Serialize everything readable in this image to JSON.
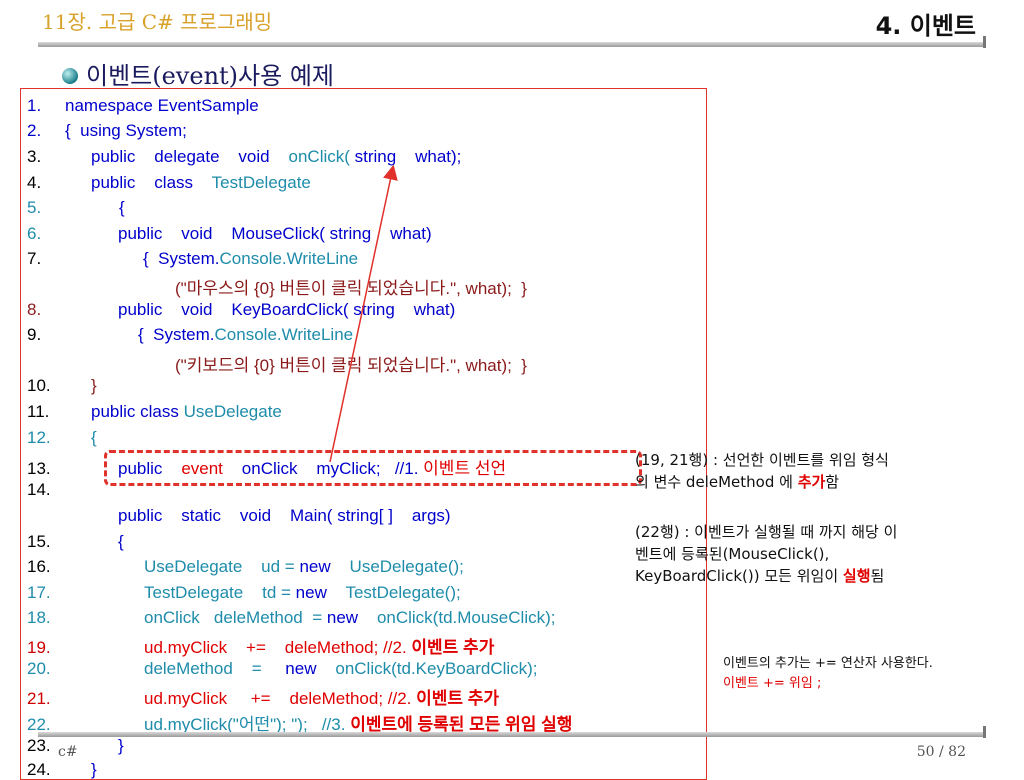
{
  "header": {
    "chapter": "11장. 고급 C# 프로그래밍",
    "section": "4. 이벤트",
    "heading": "이벤트(event)사용 예제"
  },
  "code": {
    "l1": {
      "num": "1.",
      "text": "namespace EventSample"
    },
    "l2": {
      "num": "2.",
      "text": "{  using System;"
    },
    "l3": {
      "num": "3.",
      "a": "public    delegate    void    ",
      "b": "onClick(",
      "c": " string    what);"
    },
    "l4": {
      "num": "4.",
      "a": "public    class    ",
      "b": "TestDelegate"
    },
    "l5": {
      "num": "5.",
      "text": "{"
    },
    "l6": {
      "num": "6.",
      "text": "public    void    MouseClick( string    what)"
    },
    "l7": {
      "num": "7.",
      "a": "{  System.",
      "b": "Console.WriteLine"
    },
    "l7b": {
      "text": "(\"마우스의 {0} 버튼이 클릭 되었습니다.\", what);  }"
    },
    "l8": {
      "num": "8.",
      "text": "public    void    KeyBoardClick( string    what)"
    },
    "l9": {
      "num": "9.",
      "a": "{  System.",
      "b": "Console.WriteLine"
    },
    "l9b": {
      "text": "(\"키보드의 {0} 버튼이 클릭 되었습니다.\", what);  }"
    },
    "l10": {
      "num": "10.",
      "text": "}"
    },
    "l11": {
      "num": "11.",
      "a": "public class ",
      "b": "UseDelegate"
    },
    "l12": {
      "num": "12.",
      "text": "{"
    },
    "l13": {
      "num": "13.",
      "a": "public    ",
      "b": "event    ",
      "c": "onClick    myClick;   //1. ",
      "d": "이벤트 선언"
    },
    "l14": {
      "num": "14.",
      "text": ""
    },
    "l14b": {
      "text": "public    static    void    Main( string[ ]    args)"
    },
    "l15": {
      "num": "15.",
      "text": "{"
    },
    "l16": {
      "num": "16.",
      "a": "UseDelegate    ud = ",
      "b": "new",
      "c": "    UseDelegate();"
    },
    "l17": {
      "num": "17.",
      "a": "TestDelegate    td = ",
      "b": "new",
      "c": "    TestDelegate();"
    },
    "l18": {
      "num": "18.",
      "a": "onClick   deleMethod  = ",
      "b": "new",
      "c": "    onClick(td.MouseClick);"
    },
    "l19": {
      "num": "19.",
      "a": "ud.myClick    +=    deleMethod; //2. ",
      "b": "이벤트 추가"
    },
    "l20": {
      "num": "20.",
      "a": "deleMethod    =     ",
      "b": "new",
      "c": "    onClick(td.KeyBoardClick);"
    },
    "l21": {
      "num": "21.",
      "a": "ud.myClick     +=    deleMethod; //2. ",
      "b": "이벤트 추가"
    },
    "l22": {
      "num": "22.",
      "a": "ud.myClick(\"어떤\"); \");   //3. ",
      "b": "이벤트에 등록된 모든 위임 실행"
    },
    "l23": {
      "num": "23.",
      "text": "}"
    },
    "l24": {
      "num": "24.",
      "text": "}"
    }
  },
  "notes": {
    "n1_a": "(19, 21행) : 선언한 이벤트를 위임 형식",
    "n1_b": "의 변수 deleMethod 에 ",
    "n1_c": "추가",
    "n1_d": "함",
    "n2_a": "(22행) : 이벤트가 실행될 때 까지 해당 이",
    "n2_b": "벤트에 등록된(MouseClick(),",
    "n2_c": "KeyBoardClick()) 모든 위임이 ",
    "n2_d": "실행",
    "n2_e": "됨",
    "n3_a": "이벤트의 추가는 += 연산자 사용한다.",
    "n3_b": "이벤트 += 위임 ;"
  },
  "footer": {
    "left": "c#",
    "page": "50 / 82"
  },
  "colors": {
    "accent_gold": "#d8a12a",
    "code_blue": "#0000cc",
    "code_teal": "#1e8caa",
    "highlight_red": "#e00000"
  }
}
